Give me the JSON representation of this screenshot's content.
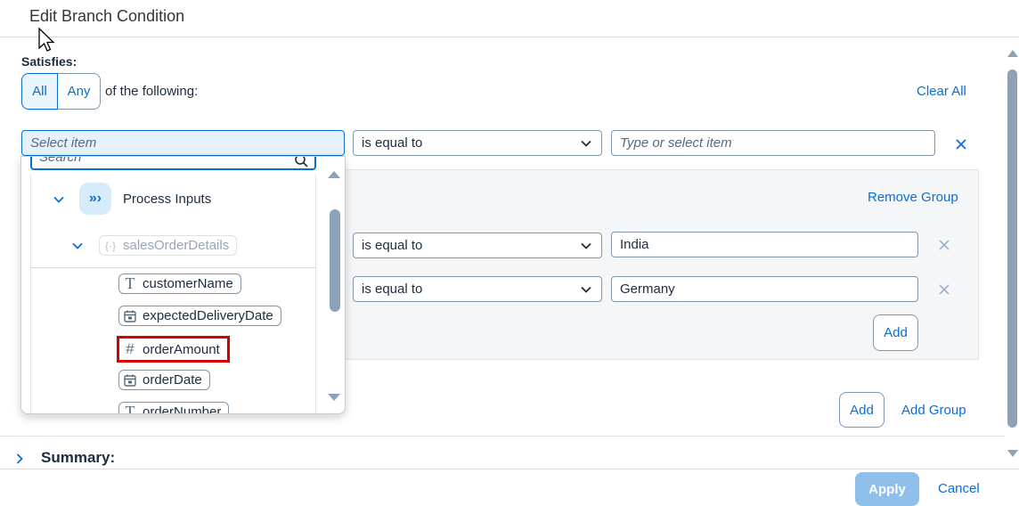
{
  "dialog": {
    "title": "Edit Branch Condition"
  },
  "satisfies": {
    "label": "Satisfies:",
    "options": [
      "All",
      "Any"
    ],
    "selected": "All",
    "suffix": "of the following:",
    "clear_all": "Clear All"
  },
  "row1": {
    "item_placeholder": "Select item",
    "operator": "is equal to",
    "value_placeholder": "Type or select item"
  },
  "group": {
    "remove_label": "Remove Group",
    "rows": [
      {
        "operator": "is equal to",
        "value": "India"
      },
      {
        "operator": "is equal to",
        "value": "Germany"
      }
    ],
    "add_label": "Add"
  },
  "outer_actions": {
    "add_label": "Add",
    "add_group_label": "Add Group"
  },
  "dropdown": {
    "search_placeholder": "Search",
    "root": "Process Inputs",
    "parent": "salesOrderDetails",
    "fields": [
      {
        "name": "customerName",
        "type_icon": "text-icon"
      },
      {
        "name": "expectedDeliveryDate",
        "type_icon": "calendar-icon"
      },
      {
        "name": "orderAmount",
        "type_icon": "number-icon"
      },
      {
        "name": "orderDate",
        "type_icon": "calendar-icon"
      },
      {
        "name": "orderNumber",
        "type_icon": "text-icon"
      }
    ]
  },
  "summary": {
    "label": "Summary:"
  },
  "footer": {
    "apply": "Apply",
    "cancel": "Cancel"
  },
  "colors": {
    "accent": "#0a6ed1",
    "highlight": "#d40000",
    "apply_disabled": "#8fc0ec"
  }
}
